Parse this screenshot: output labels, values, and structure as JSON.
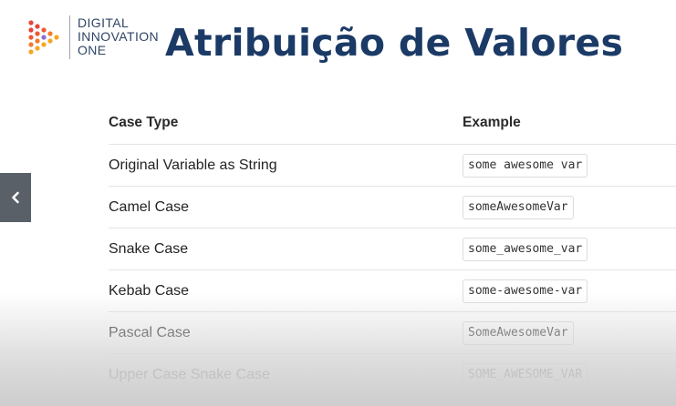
{
  "logo": {
    "lines": [
      "DIGITAL",
      "INNOVATION",
      "ONE"
    ],
    "colors": [
      "#e8423b",
      "#f07a2e",
      "#f5a623",
      "#8e6ccf"
    ]
  },
  "title": "Atribuição de Valores",
  "side_tab": {
    "icon": "chevron-left-icon"
  },
  "table": {
    "headers": [
      "Case Type",
      "Example"
    ],
    "rows": [
      {
        "type": "Original Variable as String",
        "example": "some awesome var"
      },
      {
        "type": "Camel Case",
        "example": "someAwesomeVar"
      },
      {
        "type": "Snake Case",
        "example": "some_awesome_var"
      },
      {
        "type": "Kebab Case",
        "example": "some-awesome-var"
      },
      {
        "type": "Pascal Case",
        "example": "SomeAwesomeVar"
      },
      {
        "type": "Upper Case Snake Case",
        "example": "SOME_AWESOME_VAR"
      }
    ]
  },
  "colors": {
    "title": "#1b3a66",
    "side_tab": "#5a6068"
  }
}
